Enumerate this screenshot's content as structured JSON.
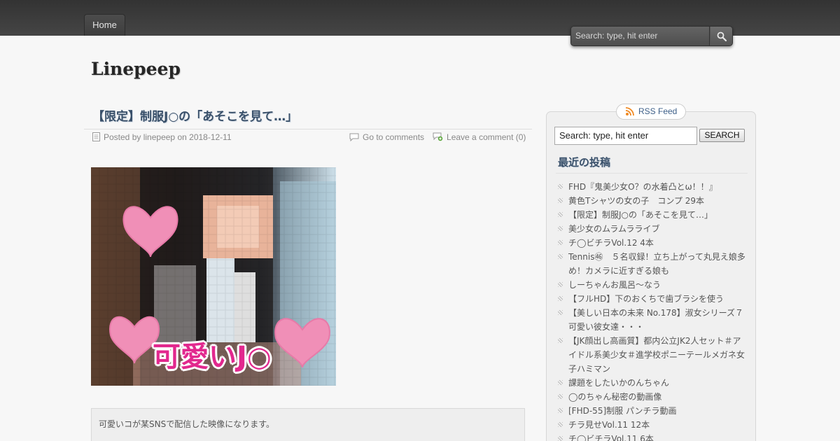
{
  "nav": {
    "home_label": "Home"
  },
  "top_search": {
    "placeholder": "Search: type, hit enter"
  },
  "site": {
    "title": "Linepeep"
  },
  "post": {
    "title": "【限定】制服J○の「あそこを見て…」",
    "posted_by_prefix": "Posted by",
    "author": "linepeep",
    "on_label": "on",
    "date": "2018-12-11",
    "goto_comments": "Go to comments",
    "leave_comment": "Leave a comment (0)",
    "thumbnail_caption": "可愛いJ○",
    "excerpt": "可愛いコが某SNSで配信した映像になります。"
  },
  "sidebar": {
    "rss_label": "RSS Feed",
    "search_value": "Search: type, hit enter",
    "search_button": "SEARCH",
    "recent_title": "最近の投稿",
    "recent_posts": [
      "FHD『鬼美少女O？の水着凸とω！！』",
      "黄色Tシャツの女の子　コンプ 29本",
      "【限定】制服J○の「あそこを見て…」",
      "美少女のムラムラライブ",
      "チ◯ビチラVol.12 4本",
      "Tennis㊻　５名収録！立ち上がって丸見え娘多め！カメラに近すぎる娘も",
      "しーちゃんお風呂～なう",
      "【フルHD】下のおくちで歯ブラシを使う",
      "【美しい日本の未来 No.178】淑女シリーズ７　可愛い彼女達・・・",
      "【JK顔出し高画質】都内公立JK2人セット＃アイドル系美少女＃進学校ポニーテールメガネ女子ハミマン",
      "課題をしたいかのんちゃん",
      "◯のちゃん秘密の動画像",
      "[FHD-55]制服 パンチラ動画",
      "チラ見せVol.11 12本",
      "チ◯ビチラVol.11 6本"
    ]
  },
  "colors": {
    "topbar": "#3d3d3d",
    "title_blue": "#39506a",
    "link_blue": "#3d5f88",
    "page_bg": "#f7f7f7"
  }
}
